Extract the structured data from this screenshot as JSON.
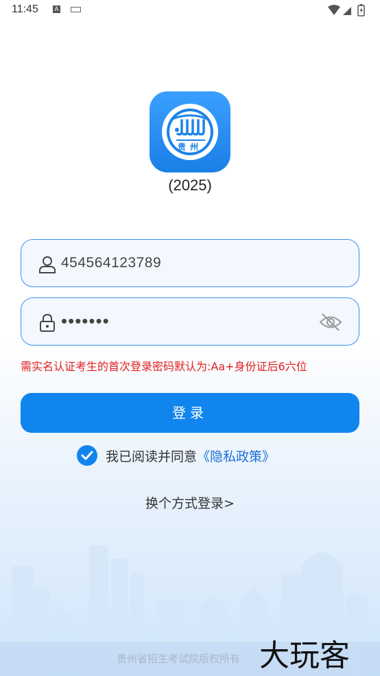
{
  "status_bar": {
    "time": "11:45",
    "a_badge": "A"
  },
  "logo": {
    "text": "贵州",
    "icon": "guizhou-exam-logo"
  },
  "year_label": "(2025)",
  "form": {
    "username": "454564123789",
    "password_masked": "•••••••",
    "hint": "需实名认证考生的首次登录密码默认为:Aa+身份证后6六位"
  },
  "login_button": "登录",
  "agreement": {
    "prefix": "我已阅读并同意",
    "link": "《隐私政策》",
    "checked": true
  },
  "switch_method": "换个方式登录>",
  "footer": {
    "copyright": "贵州省招生考试院版权所有",
    "watermark": "大玩客"
  },
  "colors": {
    "primary": "#1185ee",
    "hint": "#e02020",
    "link": "#1a6fd6"
  }
}
